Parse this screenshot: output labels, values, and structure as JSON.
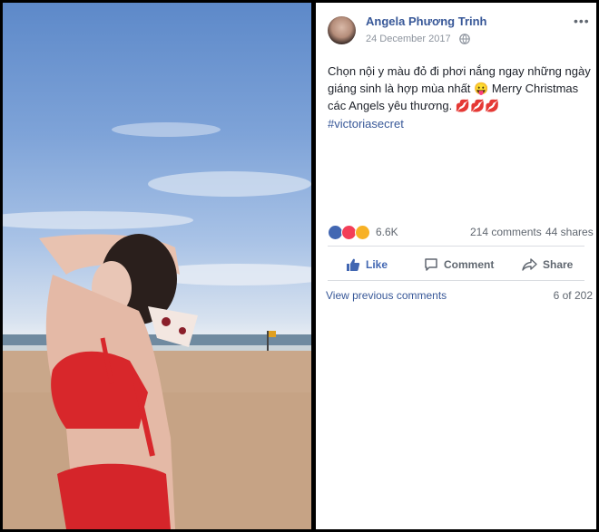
{
  "post": {
    "author": "Angela Phương Trinh",
    "date": "24 December 2017",
    "text": "Chọn nội y màu đỏ đi phơi nắng ngay những ngày giáng sinh là hợp mùa nhất 😛 Merry Christmas các Angels yêu thương. 💋💋💋",
    "hashtag": "#victoriasecret",
    "more_label": "•••"
  },
  "stats": {
    "reactions_count": "6.6K",
    "comments": "214 comments",
    "shares": "44 shares"
  },
  "actions": {
    "like": "Like",
    "comment": "Comment",
    "share": "Share"
  },
  "comments": {
    "view_previous": "View previous comments",
    "page": "6 of 202"
  },
  "colors": {
    "link_blue": "#385898",
    "like_blue": "#4267b2",
    "muted": "#606770"
  }
}
